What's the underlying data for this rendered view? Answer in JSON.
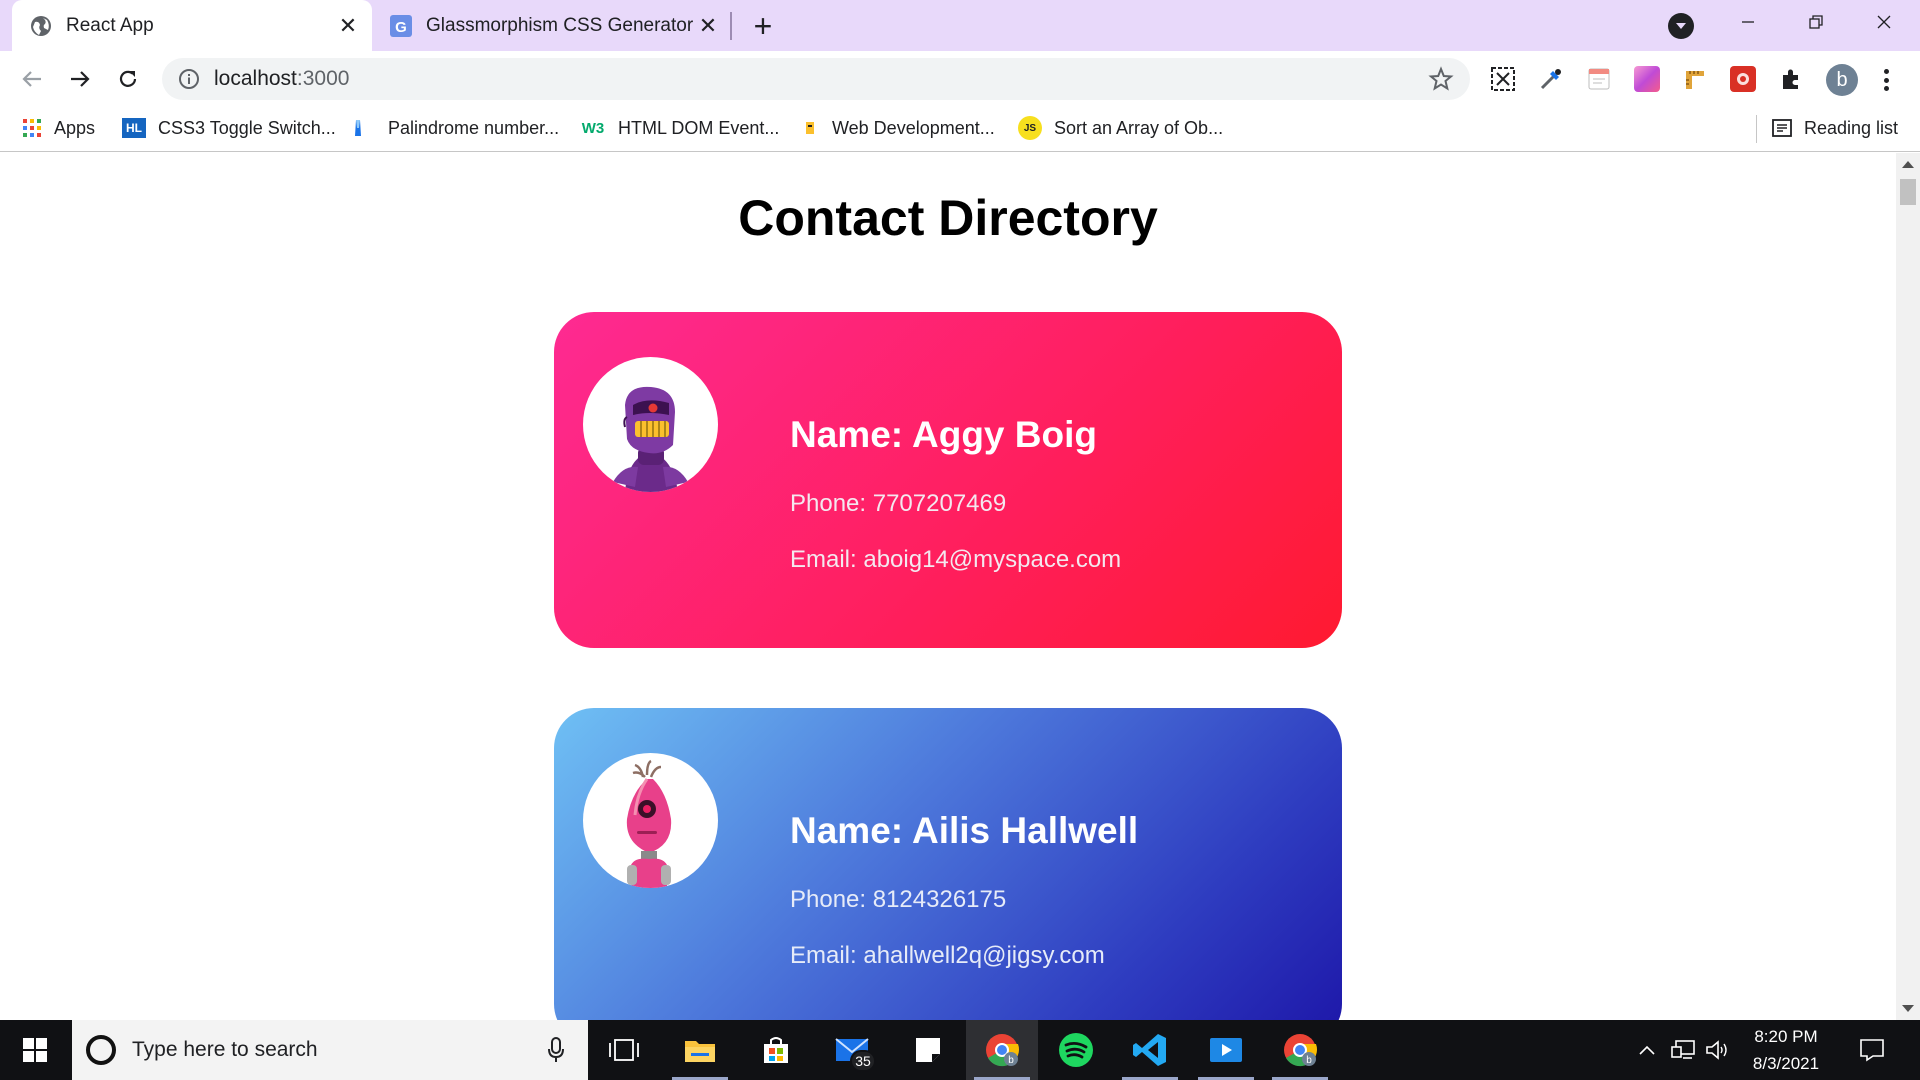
{
  "browser": {
    "tabs": [
      {
        "title": "React App",
        "active": true,
        "icon": "globe-icon"
      },
      {
        "title": "Glassmorphism CSS Generator",
        "active": false,
        "icon": "g-favicon-icon"
      }
    ],
    "new_tab_symbol": "+",
    "close_symbol": "✕",
    "url_host": "localhost",
    "url_path": ":3000",
    "profile_initial": "b"
  },
  "bookmarks": [
    {
      "label": "Apps",
      "icon": "apps-grid-icon"
    },
    {
      "label": "CSS3 Toggle Switch...",
      "icon": "HL"
    },
    {
      "label": "Palindrome number...",
      "icon": "bookmark-icon"
    },
    {
      "label": "HTML DOM Event...",
      "icon": "W3"
    },
    {
      "label": "Web Development...",
      "icon": "bookmark-icon"
    },
    {
      "label": "Sort an Array of Ob...",
      "icon": "JS"
    },
    {
      "label": "Reading list",
      "icon": "reading-list-icon"
    }
  ],
  "page": {
    "title": "Contact Directory",
    "contacts": [
      {
        "name": "Name: Aggy Boig",
        "phone": "Phone: 7707207469",
        "email": "Email: aboig14@myspace.com",
        "avatar": "purple-robot-avatar"
      },
      {
        "name": "Name: Ailis Hallwell",
        "phone": "Phone: 8124326175",
        "email": "Email: ahallwell2q@jigsy.com",
        "avatar": "pink-robot-avatar"
      }
    ]
  },
  "taskbar": {
    "search_placeholder": "Type here to search",
    "mail_badge": "35",
    "time": "8:20 PM",
    "date": "8/3/2021"
  },
  "colors": {
    "tabstrip": "#e8d9fa",
    "card1_gradient": [
      "#fe2a92",
      "#ff1a30"
    ],
    "card2_gradient": [
      "#6fc0f4",
      "#1d16a8"
    ],
    "taskbar": "#101114"
  }
}
